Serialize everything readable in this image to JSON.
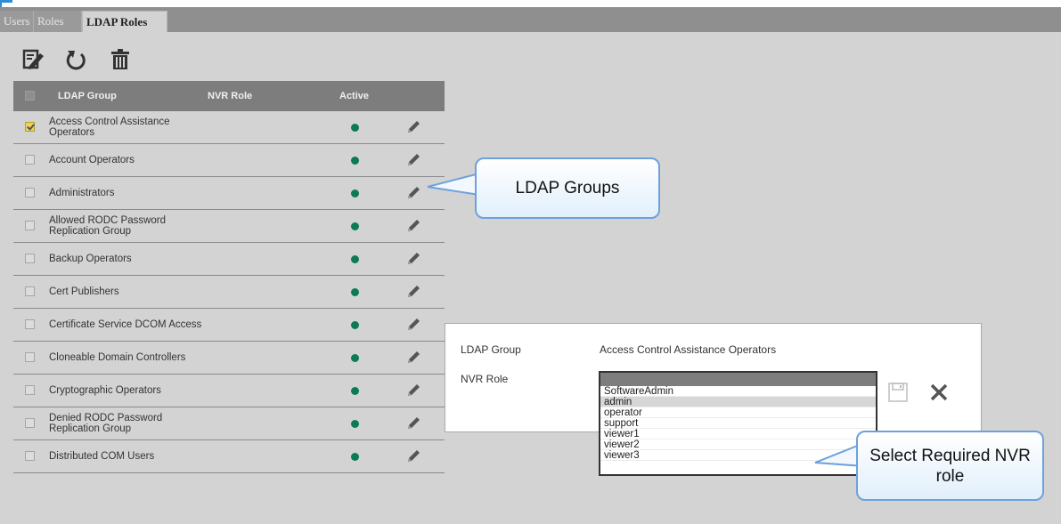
{
  "tabs": [
    {
      "label": "Users",
      "active": false
    },
    {
      "label": "Roles",
      "active": false
    },
    {
      "label": "LDAP Roles",
      "active": true
    }
  ],
  "toolbar": {
    "icons": [
      "edit-icon",
      "refresh-icon",
      "delete-icon"
    ]
  },
  "grid": {
    "columns": [
      "LDAP Group",
      "NVR Role",
      "Active"
    ],
    "rows": [
      {
        "name": "Access Control Assistance Operators",
        "checked": true
      },
      {
        "name": "Account Operators",
        "checked": false
      },
      {
        "name": "Administrators",
        "checked": false
      },
      {
        "name": "Allowed RODC Password Replication Group",
        "checked": false
      },
      {
        "name": "Backup Operators",
        "checked": false
      },
      {
        "name": "Cert Publishers",
        "checked": false
      },
      {
        "name": "Certificate Service DCOM Access",
        "checked": false
      },
      {
        "name": "Cloneable Domain Controllers",
        "checked": false
      },
      {
        "name": "Cryptographic Operators",
        "checked": false
      },
      {
        "name": "Denied RODC Password Replication Group",
        "checked": false
      },
      {
        "name": "Distributed COM Users",
        "checked": false
      }
    ]
  },
  "callouts": {
    "ldap_groups": "LDAP Groups",
    "select_role": "Select Required NVR role"
  },
  "dialog": {
    "ldap_group_label": "LDAP Group",
    "ldap_group_value": "Access Control Assistance Operators",
    "nvr_role_label": "NVR Role",
    "role_options": [
      "SoftwareAdmin",
      "admin",
      "operator",
      "support",
      "viewer1",
      "viewer2",
      "viewer3"
    ],
    "selected_option": "admin"
  },
  "colors": {
    "active_dot": "#0c7a58",
    "header_bg": "#7d7d7d",
    "panel_bg": "#d3d3d3",
    "callout_border": "#6da1dd"
  }
}
